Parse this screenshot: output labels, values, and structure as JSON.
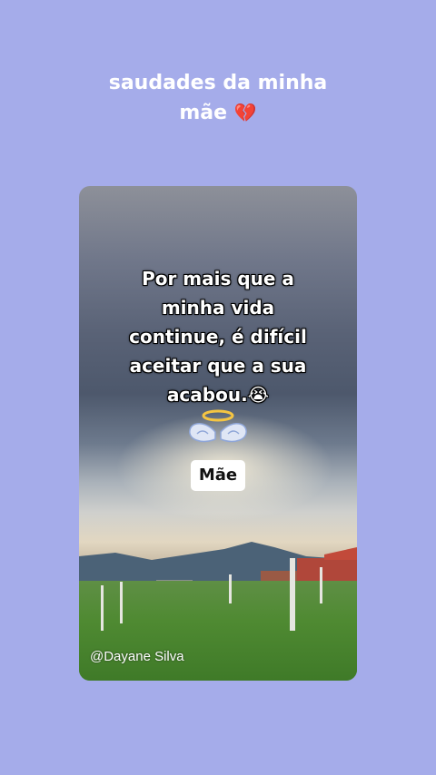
{
  "header": {
    "title_line1": "saudades da minha",
    "title_line2": "mãe",
    "title_emoji": "💔"
  },
  "card": {
    "quote_lines": [
      "Por mais que a",
      "minha vida",
      "continue, é difícil",
      "aceitar que a sua",
      "acabou.😭"
    ],
    "badge_label": "Mãe",
    "credit": "@Dayane Silva",
    "halo_icon": "angel-halo-icon"
  },
  "colors": {
    "background": "#a5acea",
    "text": "#ffffff",
    "heart": "#d6303b"
  }
}
